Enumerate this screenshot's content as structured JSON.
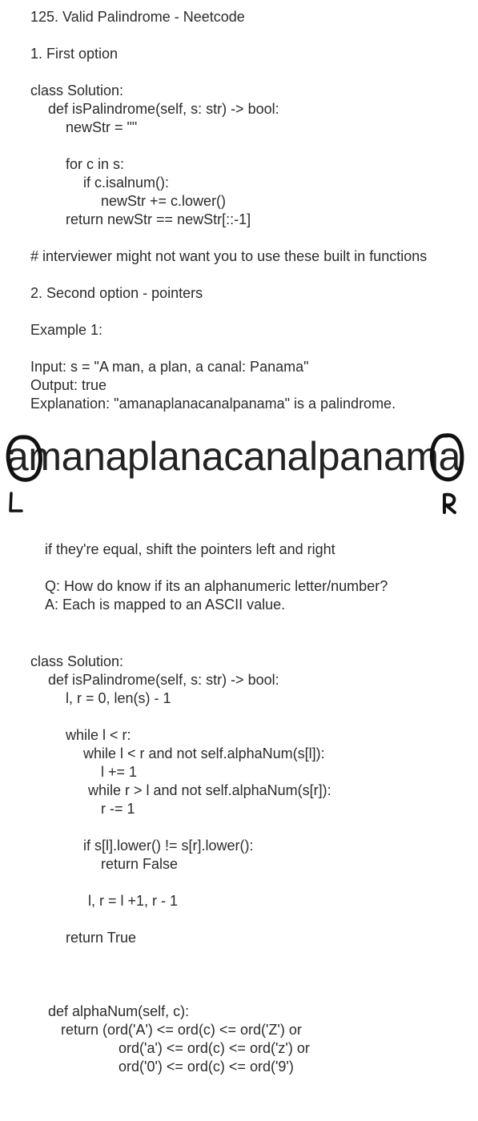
{
  "title": "125. Valid Palindrome - Neetcode",
  "option1": {
    "heading": "1. First option",
    "code": [
      "class Solution:",
      "def isPalindrome(self, s: str) -> bool:",
      "newStr = \"\"",
      "for c in s:",
      "if c.isalnum():",
      "newStr += c.lower()",
      "return newStr == newStr[::-1]"
    ],
    "comment": "# interviewer might not want you to use these built in functions"
  },
  "option2": {
    "heading": "2. Second option - pointers",
    "example_heading": "Example 1:",
    "input": "Input: s = \"A man, a plan, a canal: Panama\"",
    "output": "Output: true",
    "explanation": "Explanation: \"amanaplanacanalpanama\" is a palindrome."
  },
  "diagram": {
    "word": "amanaplanacanalpanama",
    "left_label": "L",
    "right_label": "R"
  },
  "notes": {
    "shift": "if they're equal, shift the pointers left and right",
    "question": "Q: How do know if its an alphanumeric letter/number?",
    "answer": "A: Each is mapped to an ASCII value."
  },
  "solution2": {
    "code": [
      "class Solution:",
      "def isPalindrome(self, s: str) -> bool:",
      "l, r = 0, len(s) - 1",
      "while l < r:",
      "while l < r and not self.alphaNum(s[l]):",
      "l += 1",
      "while r > l and not self.alphaNum(s[r]):",
      "r -= 1",
      "if s[l].lower() != s[r].lower():",
      "return False",
      "l, r = l +1, r - 1",
      "return True"
    ]
  },
  "alphanum": {
    "code": [
      "def alphaNum(self, c):",
      "return (ord('A') <= ord(c) <= ord('Z') or",
      "ord('a') <= ord(c) <= ord('z') or",
      "ord('0') <= ord(c) <= ord('9')"
    ]
  }
}
